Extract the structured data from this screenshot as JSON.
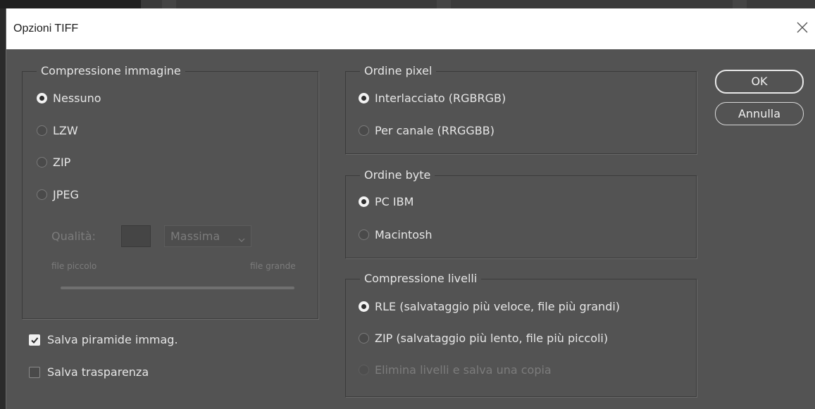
{
  "window": {
    "title": "Opzioni TIFF"
  },
  "buttons": {
    "ok": "OK",
    "cancel": "Annulla"
  },
  "image_compression": {
    "legend": "Compressione immagine",
    "options": [
      {
        "label": "Nessuno",
        "selected": true
      },
      {
        "label": "LZW",
        "selected": false
      },
      {
        "label": "ZIP",
        "selected": false
      },
      {
        "label": "JPEG",
        "selected": false
      }
    ],
    "quality_label": "Qualità:",
    "quality_value": "",
    "quality_preset": "Massima",
    "small_file_label": "file piccolo",
    "large_file_label": "file grande"
  },
  "save_pyramid": {
    "label": "Salva piramide immag.",
    "checked": true
  },
  "save_transparency": {
    "label": "Salva trasparenza",
    "checked": false
  },
  "pixel_order": {
    "legend": "Ordine pixel",
    "options": [
      {
        "label": "Interlacciato (RGBRGB)",
        "selected": true
      },
      {
        "label": "Per canale (RRGGBB)",
        "selected": false
      }
    ]
  },
  "byte_order": {
    "legend": "Ordine byte",
    "options": [
      {
        "label": "PC IBM",
        "selected": true
      },
      {
        "label": "Macintosh",
        "selected": false
      }
    ]
  },
  "layer_compression": {
    "legend": "Compressione livelli",
    "options": [
      {
        "label": "RLE (salvataggio più veloce, file più grandi)",
        "selected": true
      },
      {
        "label": "ZIP (salvataggio più lento, file più piccoli)",
        "selected": false
      },
      {
        "label": "Elimina livelli e salva una copia",
        "selected": false,
        "disabled": true
      }
    ]
  },
  "colors": {
    "dialog_bg": "#535353",
    "titlebar_bg": "#ffffff",
    "text": "#e6e6e6",
    "disabled_text": "#7c7c7c"
  }
}
